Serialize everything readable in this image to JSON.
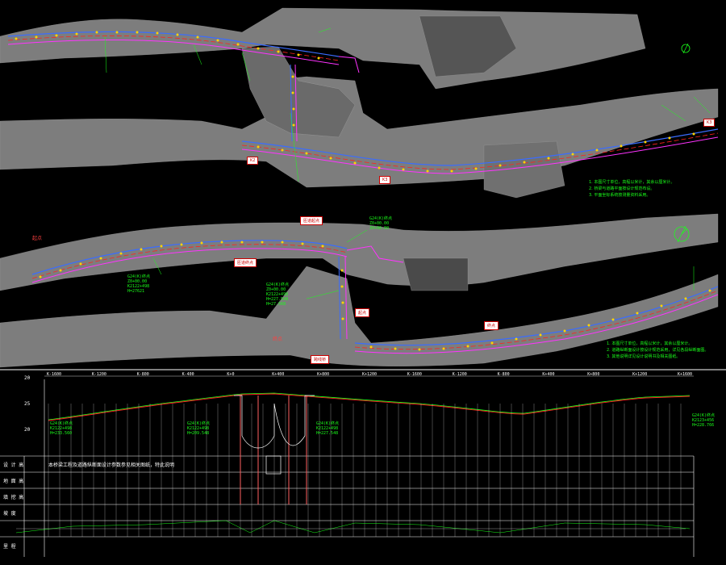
{
  "drawing": {
    "background_color": "#000000",
    "terrain_color": "#8a8a8a",
    "road_colors": {
      "edge_blue": "#3a6cff",
      "edge_magenta": "#ff33ff",
      "center_red": "#ff2020",
      "marker_yellow": "#ffd400",
      "label_green": "#1aff1a"
    }
  },
  "plan_top": {
    "left_tag": "K2",
    "mid_tag": "K3",
    "right_tag": "K3",
    "notes": [
      "1. 本图尺寸单位，高程以米计，其余以厘米计。",
      "2. 桥梁与道路平面按设计规范布设。",
      "3. 平面坐标系统按测量资料采用。"
    ]
  },
  "plan_bottom": {
    "tags": [
      "匝道起点",
      "匝道终点",
      "起点",
      "终点",
      "跨线桥"
    ],
    "left_label": "起点",
    "left_label2": "终点",
    "green_block_left": "G24(K)终点\nZ0+00.00\nK2122+498\nH=27621",
    "green_block_mid": "G24(K)终点\nZ0+00.00\nK2122+498\nH=227.548\nH=27.568",
    "green_block_top": "G24(K)终点\nZ0+00.00\nZ0+00.00",
    "notes": [
      "1. 本图尺寸单位，高程以米计，其余以厘米计。",
      "2. 道路纵断面设计按设计规范采用，详见各段纵断面图。",
      "3. 其他说明详见设计说明书及相关图纸。"
    ]
  },
  "profile": {
    "chainage_marks": [
      "K-1600",
      "K-1200",
      "K-800",
      "K-400",
      "K+0",
      "K+400",
      "K+800",
      "K+1200",
      "K-1600",
      "K-1200",
      "K-800",
      "K+400",
      "K+800",
      "K+1200",
      "K+1600"
    ],
    "elev_ticks": [
      "20",
      "25",
      "20"
    ],
    "row_labels": [
      "设 计 高",
      "地 面 高",
      "填 挖 高",
      "坡 度",
      "里 程"
    ],
    "left_block": "G24(K)终点\nK2122+498\nH=233.560",
    "mid_block": "G24(K)终点\nK2122+498\nH=209.548",
    "mid_block2": "G24(K)终点\nK2122+498\nH=227.548",
    "right_block": "G24(K)终点\nK2123+456\nH=228.766",
    "remark_row": "本桥梁工程及道路纵断面设计参数参见相关图纸，特此说明"
  }
}
